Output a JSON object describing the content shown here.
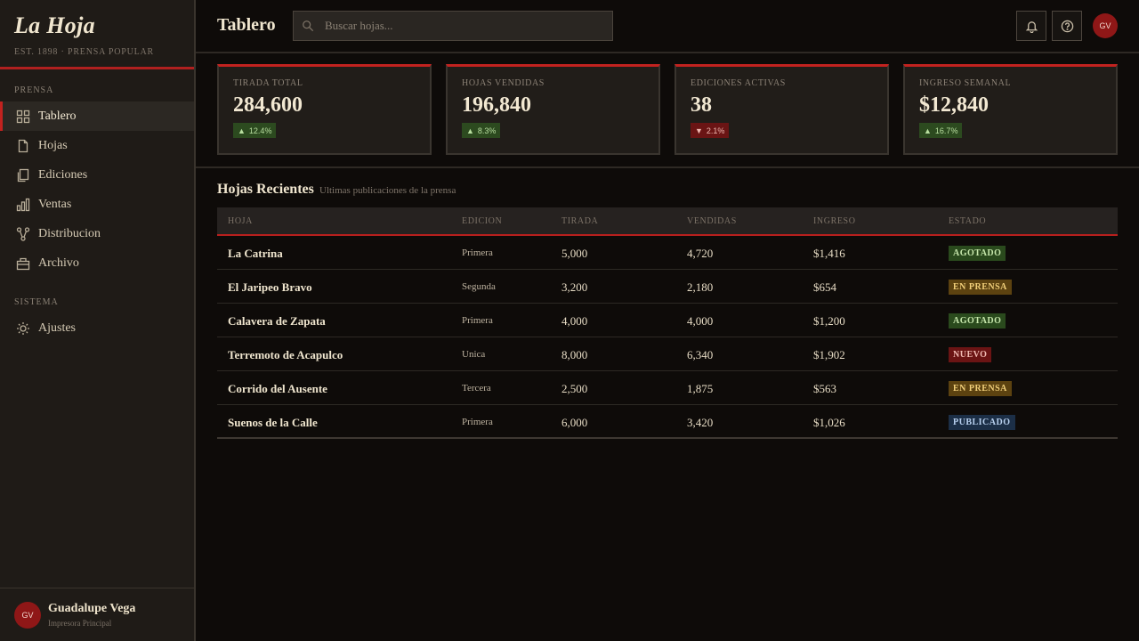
{
  "brand": {
    "name": "La Hoja",
    "subtitle": "EST. 1898 · PRENSA POPULAR"
  },
  "sidebar": {
    "section_prensa": "PRENSA",
    "items": [
      {
        "label": "Tablero",
        "icon": "grid-icon",
        "active": true
      },
      {
        "label": "Hojas",
        "icon": "file-icon"
      },
      {
        "label": "Ediciones",
        "icon": "copy-icon"
      },
      {
        "label": "Ventas",
        "icon": "bar-chart-icon"
      },
      {
        "label": "Distribucion",
        "icon": "share-icon"
      },
      {
        "label": "Archivo",
        "icon": "archive-icon"
      }
    ],
    "section_sistema": "SISTEMA",
    "system_items": [
      {
        "label": "Ajustes",
        "icon": "sun-icon"
      }
    ]
  },
  "user": {
    "initials": "GV",
    "name": "Guadalupe Vega",
    "role": "Impresora Principal"
  },
  "header": {
    "title": "Tablero",
    "search_placeholder": "Buscar hojas...",
    "avatar_initials": "GV"
  },
  "stats": [
    {
      "label": "TIRADA TOTAL",
      "value": "284,600",
      "delta": "12.4%",
      "direction": "up"
    },
    {
      "label": "HOJAS VENDIDAS",
      "value": "196,840",
      "delta": "8.3%",
      "direction": "up"
    },
    {
      "label": "EDICIONES ACTIVAS",
      "value": "38",
      "delta": "2.1%",
      "direction": "down"
    },
    {
      "label": "INGRESO SEMANAL",
      "value": "$12,840",
      "delta": "16.7%",
      "direction": "up"
    }
  ],
  "recent": {
    "title": "Hojas Recientes",
    "subtitle": "Ultimas publicaciones de la prensa",
    "columns": [
      "HOJA",
      "EDICION",
      "TIRADA",
      "VENDIDAS",
      "INGRESO",
      "ESTADO"
    ],
    "rows": [
      {
        "hoja": "La Catrina",
        "edicion": "Primera",
        "tirada": "5,000",
        "vendidas": "4,720",
        "ingreso": "$1,416",
        "estado": "AGOTADO"
      },
      {
        "hoja": "El Jaripeo Bravo",
        "edicion": "Segunda",
        "tirada": "3,200",
        "vendidas": "2,180",
        "ingreso": "$654",
        "estado": "EN PRENSA"
      },
      {
        "hoja": "Calavera de Zapata",
        "edicion": "Primera",
        "tirada": "4,000",
        "vendidas": "4,000",
        "ingreso": "$1,200",
        "estado": "AGOTADO"
      },
      {
        "hoja": "Terremoto de Acapulco",
        "edicion": "Unica",
        "tirada": "8,000",
        "vendidas": "6,340",
        "ingreso": "$1,902",
        "estado": "NUEVO"
      },
      {
        "hoja": "Corrido del Ausente",
        "edicion": "Tercera",
        "tirada": "2,500",
        "vendidas": "1,875",
        "ingreso": "$563",
        "estado": "EN PRENSA"
      },
      {
        "hoja": "Suenos de la Calle",
        "edicion": "Primera",
        "tirada": "6,000",
        "vendidas": "3,420",
        "ingreso": "$1,026",
        "estado": "PUBLICADO"
      }
    ]
  },
  "colors": {
    "accent": "#c2221f",
    "background": "#0e0b09",
    "sidebar": "#1f1b17"
  }
}
